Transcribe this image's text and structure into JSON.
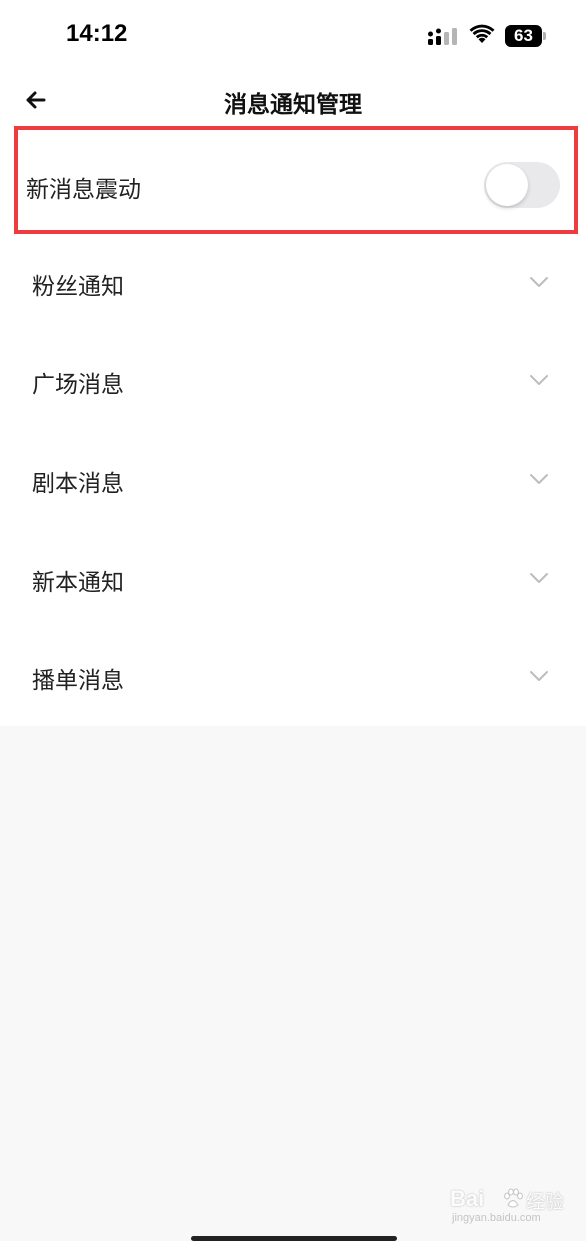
{
  "status_bar": {
    "time": "14:12",
    "battery": "63",
    "icons": [
      "signal-icon",
      "wifi-icon",
      "battery-icon"
    ]
  },
  "nav": {
    "title": "消息通知管理",
    "back_icon": "arrow-left-icon"
  },
  "vibrate": {
    "label": "新消息震动",
    "toggle_on": false,
    "highlight_color": "#ee3b3f"
  },
  "items": [
    {
      "label": "粉丝通知",
      "icon": "chevron-down-icon"
    },
    {
      "label": "广场消息",
      "icon": "chevron-down-icon"
    },
    {
      "label": "剧本消息",
      "icon": "chevron-down-icon"
    },
    {
      "label": "新本通知",
      "icon": "chevron-down-icon"
    },
    {
      "label": "播单消息",
      "icon": "chevron-down-icon"
    }
  ],
  "watermark": {
    "brand": "Bai",
    "brand_cn": "经验",
    "url": "jingyan.baidu.com"
  },
  "colors": {
    "background": "#f8f8f8",
    "surface": "#ffffff",
    "toggle_off": "#e9e9eb",
    "chevron": "#bdbdbd"
  }
}
